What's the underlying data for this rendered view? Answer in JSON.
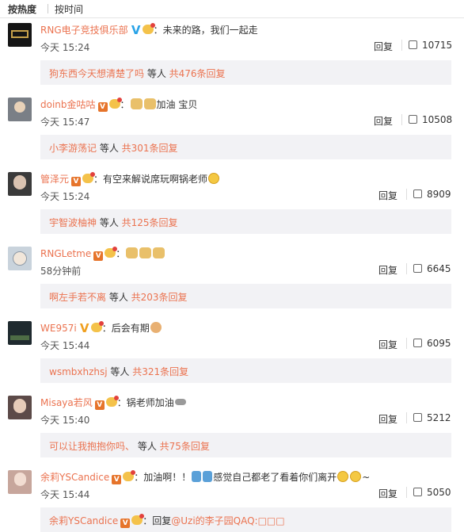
{
  "sort": {
    "hot": "按热度",
    "time": "按时间"
  },
  "comments": [
    {
      "user": "RNG电子竞技俱乐部",
      "badge": "V",
      "text": "：未来的路，我们一起走",
      "time": "今天 15:24",
      "reply": "回复",
      "likes": "10715",
      "sub_user": "狗东西今天想清楚了吗",
      "sub_mid": " 等人 ",
      "sub_count": "共476条回复",
      "avatar_color": "#151515"
    },
    {
      "user": "doinb金咕咕",
      "badge": "V",
      "text": "加油 宝贝",
      "time": "今天 15:47",
      "reply": "回复",
      "likes": "10508",
      "sub_user": "小李游荡记",
      "sub_mid": " 等人 ",
      "sub_count": "共301条回复",
      "avatar_color": "#7a7f86"
    },
    {
      "user": "管泽元",
      "badge": "V",
      "text": "：有空来解说席玩啊锅老师",
      "time": "今天 15:24",
      "reply": "回复",
      "likes": "8909",
      "sub_user": "宇智波柚神",
      "sub_mid": " 等人 ",
      "sub_count": "共125条回复",
      "avatar_color": "#3a3a3a"
    },
    {
      "user": "RNGLetme",
      "badge": "V",
      "text": "：",
      "time": "58分钟前",
      "reply": "回复",
      "likes": "6645",
      "sub_user": "啊左手若不离",
      "sub_mid": " 等人 ",
      "sub_count": "共203条回复",
      "avatar_color": "#9aa9b8"
    },
    {
      "user": "WE957i",
      "badge": "V",
      "text": "：后会有期",
      "time": "今天 15:44",
      "reply": "回复",
      "likes": "6095",
      "sub_user": "wsmbxhzhsj",
      "sub_mid": " 等人 ",
      "sub_count": "共321条回复",
      "avatar_color": "#1f2a2f"
    },
    {
      "user": "Misaya若风",
      "badge": "V",
      "text": "：锅老师加油",
      "time": "今天 15:40",
      "reply": "回复",
      "likes": "5212",
      "sub_user": "可以让我抱抱你吗、",
      "sub_mid": " 等人 ",
      "sub_count": "共75条回复",
      "avatar_color": "#5c4a48"
    },
    {
      "user": "余莉YSCandice",
      "badge": "V",
      "text": "：加油啊！！",
      "text2": "感觉自己都老了看着你们离开",
      "text3": "~",
      "time": "今天 15:44",
      "reply": "回复",
      "likes": "5050",
      "sub_user": "余莉YSCandice",
      "sub_mid": "：回复",
      "sub_count": "@Uzi的李子园QAQ:□□□",
      "avatar_color": "#c7a69c"
    }
  ],
  "colors": {
    "accent": "#eb7350",
    "sub_bg": "#f2f2f5"
  }
}
